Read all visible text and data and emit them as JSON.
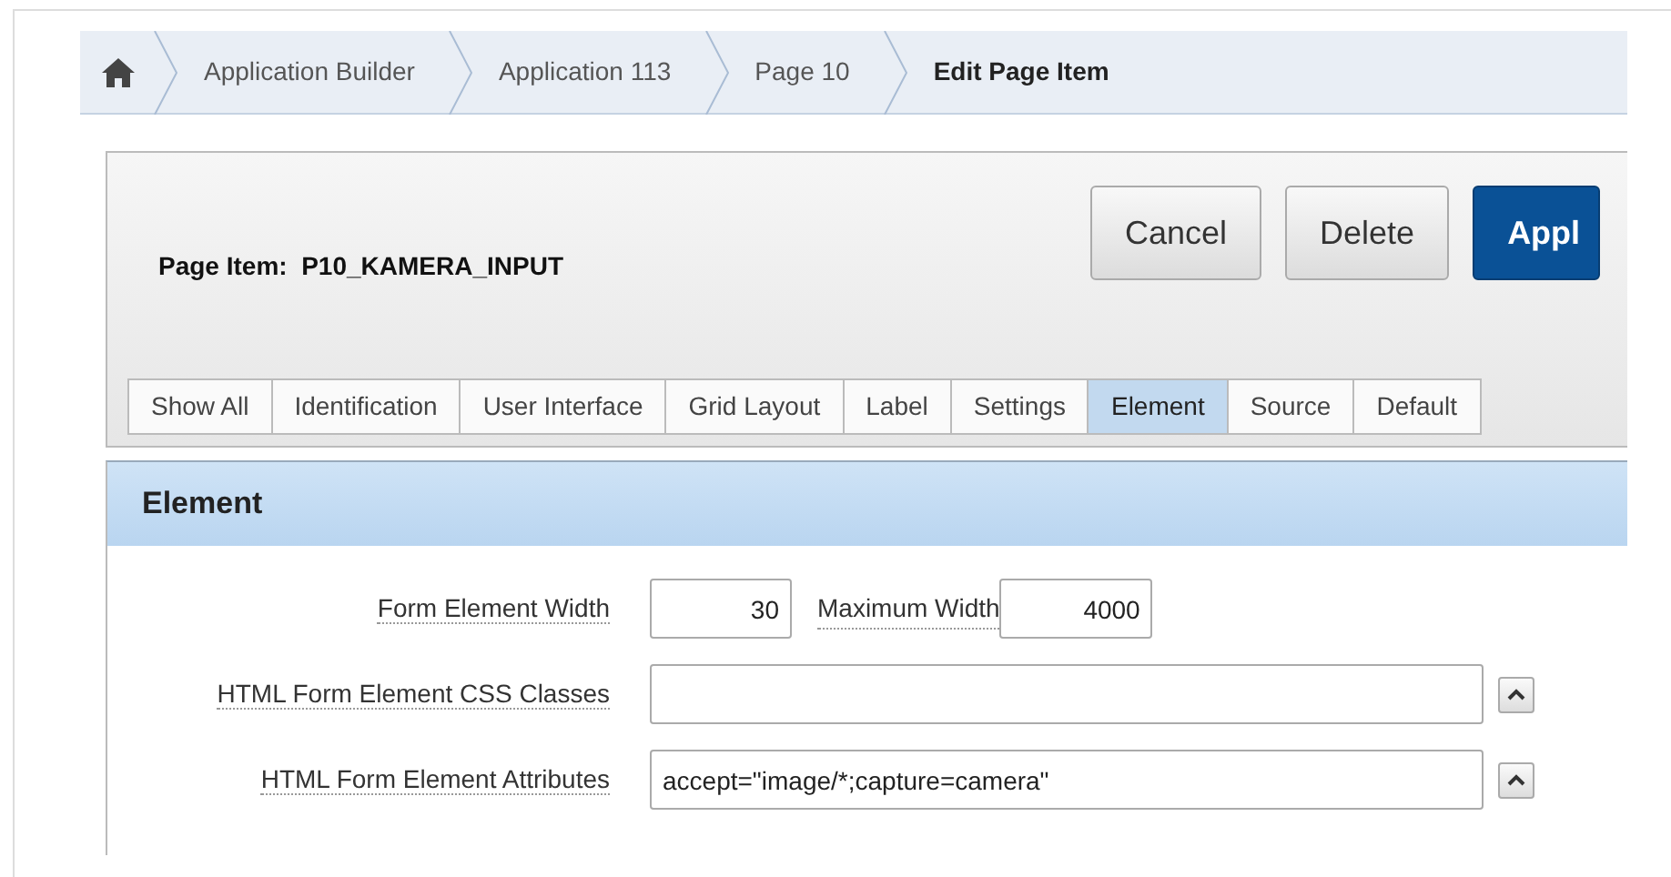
{
  "breadcrumb": [
    {
      "label": "Application Builder",
      "current": false
    },
    {
      "label": "Application 113",
      "current": false
    },
    {
      "label": "Page 10",
      "current": false
    },
    {
      "label": "Edit Page Item",
      "current": true
    }
  ],
  "header": {
    "title_label": "Page Item:",
    "title_value": "P10_KAMERA_INPUT"
  },
  "buttons": [
    {
      "label": "Cancel",
      "kind": "default"
    },
    {
      "label": "Delete",
      "kind": "default"
    },
    {
      "label": "Appl",
      "kind": "primary"
    }
  ],
  "tabs": [
    {
      "label": "Show All",
      "selected": false
    },
    {
      "label": "Identification",
      "selected": false
    },
    {
      "label": "User Interface",
      "selected": false
    },
    {
      "label": "Grid Layout",
      "selected": false
    },
    {
      "label": "Label",
      "selected": false
    },
    {
      "label": "Settings",
      "selected": false
    },
    {
      "label": "Element",
      "selected": true
    },
    {
      "label": "Source",
      "selected": false
    },
    {
      "label": "Default",
      "selected": false
    }
  ],
  "section": {
    "title": "Element"
  },
  "fields": [
    {
      "kind": "pair",
      "label": "Form Element Width",
      "value": "30",
      "label2": "Maximum Width",
      "value2": "4000"
    },
    {
      "kind": "wide",
      "label": "HTML Form Element CSS Classes"
    },
    {
      "kind": "wide",
      "label": "HTML Form Element Attributes",
      "value": "accept=\"image/*;capture=camera\""
    }
  ]
}
